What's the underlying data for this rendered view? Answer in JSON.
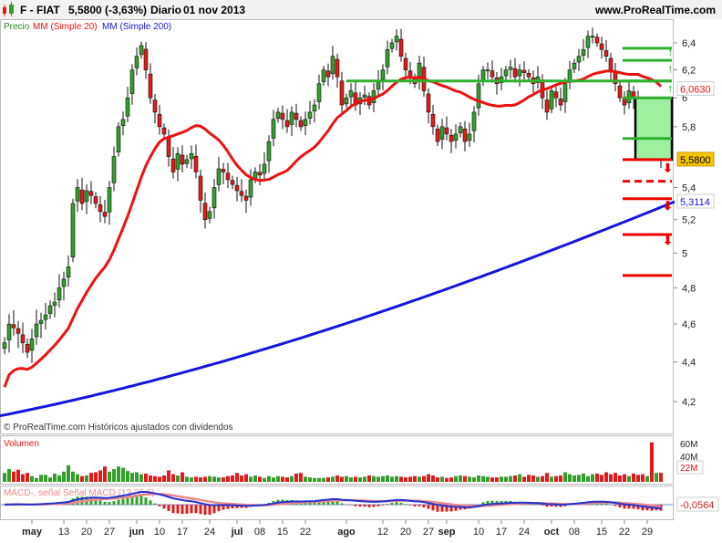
{
  "header": {
    "symbol": "F - FIAT",
    "price": "5,5800 (-3,63%)",
    "period": "Diario",
    "date": "01 nov 2013",
    "site": "www.ProRealTime.com"
  },
  "legend": {
    "price": "Precio",
    "ma20": "MM (Simple 20)",
    "ma200": "MM (Simple 200)"
  },
  "footer_note": "© ProRealTime.com Históricos ajustados con dividendos",
  "colors": {
    "up": "#33a02c",
    "down": "#e31a1c",
    "ma20": "#ee1111",
    "ma200": "#1515dd",
    "level_green": "#2fb02f",
    "level_red": "#ee0000"
  },
  "chart_data": {
    "type": "candlestick",
    "scale": "log",
    "ylim": [
      4.05,
      6.55
    ],
    "yticks": [
      "6,4",
      "6,2",
      "6",
      "5,8",
      "5,4",
      "5,2",
      "5",
      "4,8",
      "4,6",
      "4,4",
      "4,2"
    ],
    "ytick_values": [
      6.4,
      6.2,
      6.0,
      5.8,
      5.4,
      5.2,
      5.0,
      4.8,
      4.6,
      4.4,
      4.2
    ],
    "closes": [
      4.5,
      4.6,
      4.58,
      4.55,
      4.5,
      4.45,
      4.52,
      4.6,
      4.62,
      4.65,
      4.7,
      4.72,
      4.8,
      4.85,
      4.92,
      5.3,
      5.4,
      5.3,
      5.38,
      5.35,
      5.3,
      5.25,
      5.22,
      5.4,
      5.6,
      5.8,
      5.85,
      6.0,
      6.2,
      6.3,
      6.38,
      6.2,
      6.0,
      5.9,
      5.8,
      5.75,
      5.6,
      5.5,
      5.62,
      5.55,
      5.58,
      5.62,
      5.5,
      5.32,
      5.2,
      5.25,
      5.4,
      5.52,
      5.5,
      5.45,
      5.42,
      5.38,
      5.35,
      5.32,
      5.45,
      5.5,
      5.48,
      5.55,
      5.7,
      5.85,
      5.9,
      5.85,
      5.8,
      5.9,
      5.85,
      5.8,
      5.85,
      5.9,
      5.95,
      6.1,
      6.2,
      6.15,
      6.3,
      6.15,
      5.95,
      6.0,
      6.05,
      5.95,
      6.0,
      6.02,
      5.95,
      6.05,
      6.12,
      6.2,
      6.35,
      6.4,
      6.45,
      6.3,
      6.2,
      6.15,
      6.1,
      6.25,
      6.05,
      5.9,
      5.8,
      5.7,
      5.8,
      5.75,
      5.7,
      5.75,
      5.8,
      5.7,
      5.75,
      5.9,
      6.1,
      6.2,
      6.2,
      6.15,
      6.1,
      6.15,
      6.2,
      6.22,
      6.15,
      6.2,
      6.18,
      6.15,
      6.1,
      6.15,
      6.0,
      5.9,
      6.05,
      6.0,
      5.95,
      6.1,
      6.2,
      6.25,
      6.3,
      6.35,
      6.45,
      6.45,
      6.4,
      6.35,
      6.3,
      6.2,
      6.1,
      6.0,
      5.95,
      6.05,
      6.0,
      5.9,
      5.75,
      5.8,
      5.7,
      5.75,
      5.58
    ],
    "ma200_range": [
      4.13,
      5.3114
    ],
    "labels": {
      "last": "5,5800",
      "ma20": "6,0630",
      "ma200": "5,3114"
    },
    "levels_green": [
      6.36,
      6.27,
      6.12,
      6.0,
      5.72
    ],
    "levels_red": [
      5.58,
      5.44,
      5.33,
      5.11,
      4.87
    ],
    "levels_dashed": [
      5.44
    ],
    "volume": {
      "title": "Volumen",
      "unit": "M",
      "yticks": [
        "60M",
        "40M"
      ],
      "ytick_values": [
        60,
        40
      ],
      "last_label": "22M",
      "values": [
        14,
        20,
        16,
        19,
        12,
        14,
        9,
        6,
        11,
        11,
        7,
        13,
        10,
        16,
        26,
        16,
        12,
        9,
        10,
        14,
        15,
        18,
        24,
        16,
        20,
        24,
        22,
        17,
        14,
        15,
        12,
        13,
        10,
        9,
        8,
        10,
        18,
        12,
        10,
        15,
        8,
        7,
        8,
        7,
        8,
        9,
        8,
        7,
        7,
        9,
        10,
        14,
        10,
        12,
        8,
        10,
        8,
        6,
        9,
        7,
        9,
        8,
        7,
        9,
        13,
        14,
        8,
        7,
        6,
        6,
        6,
        7,
        8,
        10,
        8,
        9,
        7,
        8,
        7,
        8,
        10,
        9,
        8,
        9,
        10,
        8,
        9,
        8,
        7,
        8,
        9,
        8,
        9,
        12,
        10,
        7,
        8,
        6,
        7,
        9,
        10,
        9,
        8,
        7,
        10,
        9,
        8,
        7,
        7,
        8,
        8,
        9,
        10,
        12,
        8,
        11,
        10,
        8,
        9,
        14,
        8,
        9,
        10,
        15,
        12,
        10,
        11,
        13,
        9,
        12,
        13,
        11,
        15,
        12,
        14,
        10,
        12,
        9,
        13,
        11,
        12,
        9,
        62,
        14,
        14
      ]
    },
    "macd": {
      "title": "MACD-, señal Señal MACD (12 26 9)",
      "params": [
        12,
        26,
        9
      ],
      "last_label": "-0,0564"
    },
    "xticks": [
      {
        "label": "may",
        "index": 6,
        "bold": true
      },
      {
        "label": "13",
        "index": 13
      },
      {
        "label": "20",
        "index": 18
      },
      {
        "label": "27",
        "index": 23
      },
      {
        "label": "jun",
        "index": 29,
        "bold": true
      },
      {
        "label": "10",
        "index": 34
      },
      {
        "label": "17",
        "index": 39
      },
      {
        "label": "24",
        "index": 45
      },
      {
        "label": "jul",
        "index": 51,
        "bold": true
      },
      {
        "label": "08",
        "index": 56
      },
      {
        "label": "15",
        "index": 61
      },
      {
        "label": "22",
        "index": 66
      },
      {
        "label": "ago",
        "index": 75,
        "bold": true
      },
      {
        "label": "12",
        "index": 83
      },
      {
        "label": "20",
        "index": 88
      },
      {
        "label": "27",
        "index": 93
      },
      {
        "label": "sep",
        "index": 97,
        "bold": true
      },
      {
        "label": "10",
        "index": 104
      },
      {
        "label": "17",
        "index": 109
      },
      {
        "label": "24",
        "index": 114
      },
      {
        "label": "oct",
        "index": 120,
        "bold": true
      },
      {
        "label": "08",
        "index": 125
      },
      {
        "label": "15",
        "index": 131
      },
      {
        "label": "22",
        "index": 136
      },
      {
        "label": "29",
        "index": 141
      }
    ]
  }
}
